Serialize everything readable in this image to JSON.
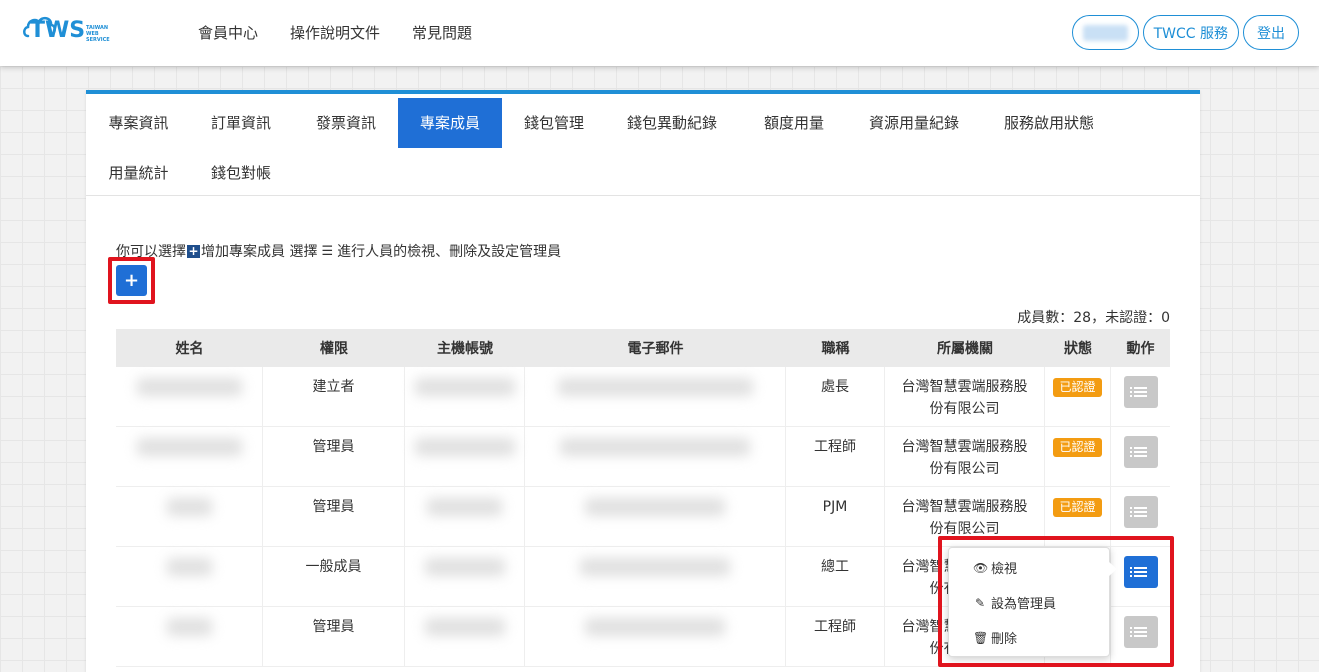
{
  "header": {
    "logo_text": "TWS",
    "logo_sub": "TAIWAN WEB SERVICE",
    "nav": [
      "會員中心",
      "操作說明文件",
      "常見問題"
    ],
    "twcc_label": "TWCC 服務",
    "logout_label": "登出"
  },
  "tabs": [
    "專案資訊",
    "訂單資訊",
    "發票資訊",
    "專案成員",
    "錢包管理",
    "錢包異動紀錄",
    "額度用量",
    "資源用量紀錄",
    "服務啟用狀態",
    "用量統計",
    "錢包對帳"
  ],
  "active_tab": "專案成員",
  "intro": {
    "part1": "你可以選擇",
    "plus": "+",
    "part2": "增加專案成員  選擇",
    "part3": "進行人員的檢視、刪除及設定管理員"
  },
  "add_button": "+",
  "member_count": "成員數：28，未認證：0",
  "table": {
    "headers": [
      "姓名",
      "權限",
      "主機帳號",
      "電子郵件",
      "職稱",
      "所屬機關",
      "狀態",
      "動作"
    ],
    "rows": [
      {
        "role": "建立者",
        "title": "處長",
        "org": "台灣智慧雲端服務股份有限公司",
        "status": "已認證"
      },
      {
        "role": "管理員",
        "title": "工程師",
        "org": "台灣智慧雲端服務股份有限公司",
        "status": "已認證"
      },
      {
        "role": "管理員",
        "title": "PJM",
        "org": "台灣智慧雲端服務股份有限公司",
        "status": "已認證"
      },
      {
        "role": "一般成員",
        "title": "總工",
        "org": "台灣智慧雲端服務股份有限公司",
        "status": ""
      },
      {
        "role": "管理員",
        "title": "工程師",
        "org": "台灣智慧雲端服務股份有限公司",
        "status": ""
      }
    ]
  },
  "dropdown": {
    "view": "檢視",
    "set_admin": "設為管理員",
    "delete": "刪除"
  },
  "colors": {
    "primary": "#1f6fd6",
    "accent_top": "#1f8fd6",
    "badge": "#f39c12",
    "highlight": "#e0141e"
  }
}
